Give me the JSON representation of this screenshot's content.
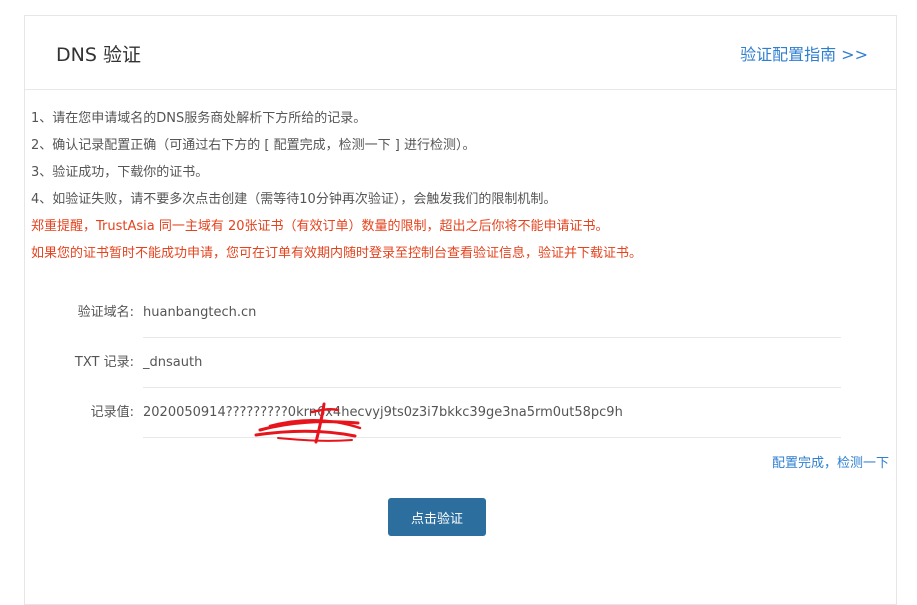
{
  "header": {
    "title": "DNS 验证",
    "guide_link": "验证配置指南 >>"
  },
  "instructions": [
    "1、请在您申请域名的DNS服务商处解析下方所给的记录。",
    "2、确认记录配置正确（可通过右下方的 [ 配置完成，检测一下 ] 进行检测）。",
    "3、验证成功，下载你的证书。",
    "4、如验证失败，请不要多次点击创建（需等待10分钟再次验证），会触发我们的限制机制。"
  ],
  "warnings": [
    "郑重提醒，TrustAsia 同一主域有 20张证书（有效订单）数量的限制，超出之后你将不能申请证书。",
    "如果您的证书暂时不能成功申请，您可在订单有效期内随时登录至控制台查看验证信息，验证并下载证书。"
  ],
  "records": [
    {
      "label": "验证域名:",
      "value": "huanbangtech.cn"
    },
    {
      "label": "TXT 记录:",
      "value": "_dnsauth"
    },
    {
      "label": "记录值:",
      "value": "2020050914?????????0krn6x4hecvyj9ts0z3i7bkkc39ge3na5rm0ut58pc9h"
    }
  ],
  "check_link": "配置完成，检测一下",
  "verify_button": "点击验证",
  "colors": {
    "link": "#2f7fd0",
    "warning": "#e4431e",
    "button": "#2c6f9e",
    "scribble": "#e8141c"
  }
}
